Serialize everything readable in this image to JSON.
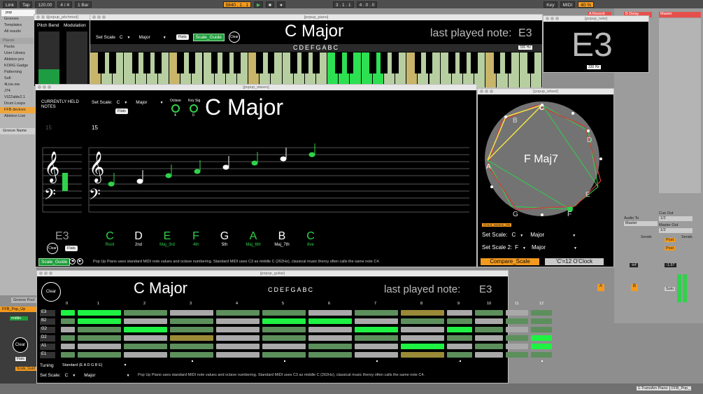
{
  "transport": {
    "link": "Link",
    "tap": "Tap",
    "tempo": "120.00",
    "sig": "4 / 4",
    "bar": "1 Bar",
    "pos1": "5840 . 1 . 1",
    "pos2": "3 . 1 . 1",
    "pos3": "4 . 0 . 0",
    "key": "Key",
    "midi": "MIDI",
    "cpu": "40 %"
  },
  "browser": {
    "search": "pop",
    "items_top": [
      "Grooves",
      "Templates",
      "All results"
    ],
    "places_header": "Places",
    "places": [
      "Packs",
      "User Library",
      "Ableton pro",
      "KORG Gadge",
      "Patterning",
      "Sufi",
      "4Live.me",
      "J74",
      "VIZZable2.1",
      "Drum Loops",
      "FFB devices",
      "Ableton Live"
    ],
    "groove_header": "Groove Name",
    "groove_pool": "Groove Pool"
  },
  "tracks": {
    "a": "A Reverb",
    "b": "B Delay",
    "master": "Master",
    "audio_to": "Audio To",
    "audio_to_val": "Master",
    "cue_out": "Cue Out",
    "cue_val": "1/2",
    "master_out": "Master Out",
    "master_val": "1/2",
    "sends": "Sends",
    "post": "Post",
    "solo": "Solo",
    "inf": "-inf",
    "v1": "-1.97",
    "send_a": "A",
    "send_b": "B",
    "bottom_track": "1-TransAm Piano",
    "bottom_track2": "FFB_Pop_"
  },
  "pitchmod": {
    "title": "[popup_pitchmod]",
    "pitch": "Pitch Bend",
    "mod": "Modulation"
  },
  "piano": {
    "title": "[popup_piano]",
    "set_scale": "Set Scale",
    "key": "C",
    "mode": "Major",
    "flats": "Flats",
    "guide": "Scale_Guide",
    "clear": "Clear",
    "heading": "C Major",
    "notes": "CDEFGABC",
    "hz": "330 Hz",
    "last_label": "last played note:",
    "last_note": "E3",
    "white_keys": [
      1,
      0,
      1,
      0,
      1,
      1,
      0,
      1,
      0,
      1,
      0,
      1,
      1,
      0,
      1,
      0,
      1,
      1,
      0,
      1,
      0,
      1,
      0,
      1,
      1,
      0,
      1,
      0,
      1,
      1,
      0,
      1,
      0,
      1,
      0,
      1,
      2,
      0,
      2,
      0,
      1,
      1,
      0,
      1,
      0,
      1,
      0,
      1,
      1,
      0,
      1,
      0,
      1,
      1,
      0,
      1,
      0,
      1,
      0,
      1,
      1
    ]
  },
  "note_win": {
    "title": "[popup_note]",
    "note": "E3",
    "hz": "330 Hz"
  },
  "staves": {
    "title": "[popup_staves]",
    "held": "CURRENTLY HELD NOTES",
    "set_scale": "Set Scale:",
    "key": "C",
    "mode": "Major",
    "flats": "Flats",
    "octave": "Octave",
    "octave_val": "4",
    "keysig": "Key Sig",
    "keysig_val": "0",
    "heading": "C Major",
    "last_note": "E3",
    "clear": "Clear",
    "flats2": "Flats",
    "guide": "Scale_Guide",
    "fifteen": "15",
    "degrees": [
      {
        "note": "C",
        "label": "Root",
        "green": true
      },
      {
        "note": "D",
        "label": "2nd",
        "green": false
      },
      {
        "note": "E",
        "label": "Maj_3rd",
        "green": true
      },
      {
        "note": "F",
        "label": "4th",
        "green": true
      },
      {
        "note": "G",
        "label": "5th",
        "green": false
      },
      {
        "note": "A",
        "label": "Maj_6th",
        "green": true
      },
      {
        "note": "B",
        "label": "Maj_7th",
        "green": false
      },
      {
        "note": "C",
        "label": "8ve",
        "green": true
      }
    ],
    "footnote": "Pop Up Piano  uses standard MIDI note values and octave numbering. Standard MIDI uses C3 as middle C (262Hz), classical music theroy often calls the same note C4."
  },
  "wheel": {
    "title": "[popup_wheel]",
    "center": "F Maj7",
    "letters": [
      {
        "t": "C",
        "a": 0,
        "hl": true
      },
      {
        "t": "B",
        "a": 330,
        "hl": false
      },
      {
        "t": "D",
        "a": 60,
        "hl": false
      },
      {
        "t": "A",
        "a": 270,
        "hl": true
      },
      {
        "t": "E",
        "a": 120,
        "hl": false
      },
      {
        "t": "G",
        "a": 210,
        "hl": false
      },
      {
        "t": "F",
        "a": 150,
        "hl": false
      }
    ],
    "chord_names": "Chord_Names_ON",
    "set_scale": "Set Scale:",
    "key": "C",
    "mode": "Major",
    "set_scale2": "Set Scale 2:",
    "key2": "F",
    "mode2": "Major",
    "compare": "Compare_Scale",
    "clock": "'C'=12  O'Clock"
  },
  "guitar": {
    "title": "[popup_guitar]",
    "clear": "Clear",
    "heading": "C Major",
    "notes": "CDEFGABC",
    "last_label": "last played note:",
    "last_note": "E3",
    "frets": [
      "0",
      "1",
      "2",
      "3",
      "4",
      "5",
      "6",
      "7",
      "8",
      "9",
      "10",
      "11",
      "12"
    ],
    "strings": [
      "E3",
      "B2",
      "G2",
      "D2",
      "A1",
      "E1"
    ],
    "tuning_label": "Tuning",
    "tuning": "Standard (E A D G B E)",
    "set_scale": "Set Scale:",
    "key": "C",
    "mode": "Major",
    "footnote": "Pop Up Piano  uses standard MIDI note values and octave numbering. Standard MIDI uses C3 as middle C (262Hz), classical music theroy often calls the same note C4.",
    "grid": [
      [
        "G",
        "G",
        "g",
        "l",
        "g",
        "g",
        "l",
        "g",
        "y",
        "l",
        "g",
        "l",
        "g"
      ],
      [
        "g",
        "G",
        "l",
        "g",
        "l",
        "G",
        "G",
        "l",
        "g",
        "g",
        "l",
        "g",
        "g"
      ],
      [
        "l",
        "g",
        "G",
        "g",
        "l",
        "g",
        "l",
        "G",
        "l",
        "G",
        "g",
        "l",
        "g"
      ],
      [
        "g",
        "g",
        "l",
        "y",
        "l",
        "g",
        "l",
        "g",
        "l",
        "g",
        "l",
        "g",
        "G"
      ],
      [
        "l",
        "l",
        "g",
        "g",
        "l",
        "l",
        "g",
        "l",
        "G",
        "l",
        "g",
        "l",
        "G"
      ],
      [
        "g",
        "g",
        "l",
        "g",
        "l",
        "g",
        "g",
        "l",
        "y",
        "g",
        "l",
        "g",
        "g"
      ]
    ]
  },
  "device": {
    "name": "FFB_Pop_Up",
    "midiin": "midiin",
    "clear": "Clear",
    "flats": "Flats",
    "guide": "Scale_Guid"
  }
}
